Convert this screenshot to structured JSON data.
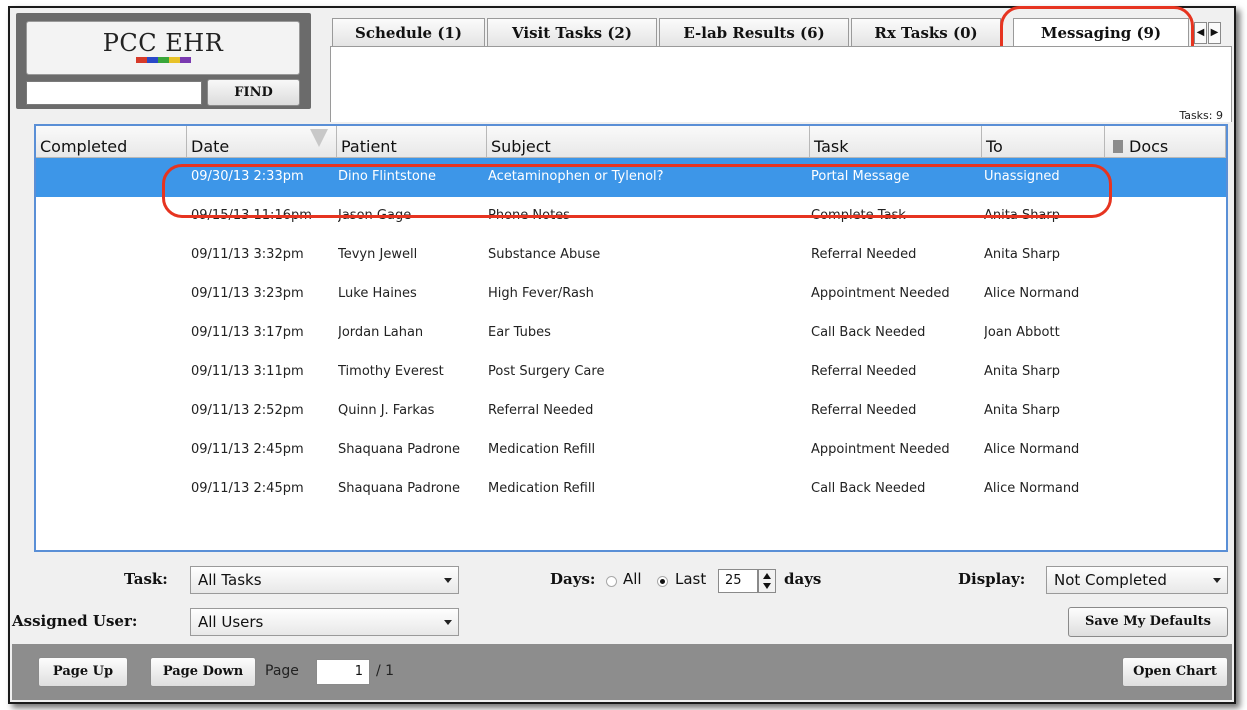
{
  "logo": {
    "text": "PCC EHR",
    "bar_colors": [
      "#d63a2a",
      "#2a49c8",
      "#3aa63a",
      "#e8c228",
      "#7a3ab0"
    ]
  },
  "find": {
    "value": "",
    "button_label": "FIND"
  },
  "tabs": [
    {
      "label": "Schedule (1)"
    },
    {
      "label": "Visit Tasks (2)"
    },
    {
      "label": "E-lab Results (6)"
    },
    {
      "label": "Rx Tasks (0)"
    },
    {
      "label": "Messaging (9)",
      "active": true
    }
  ],
  "tab_scroll": {
    "left_icon": "triangle-left-icon",
    "right_icon": "triangle-right-icon",
    "left": "◀",
    "right": "▶"
  },
  "tasks_count": "Tasks: 9",
  "table": {
    "columns": [
      "Completed",
      "Date",
      "Patient",
      "Subject",
      "Task",
      "To",
      "Docs"
    ],
    "rows": [
      {
        "completed": "",
        "date": "09/30/13 2:33pm",
        "patient": "Dino Flintstone",
        "subject": "Acetaminophen or Tylenol?",
        "task": "Portal Message",
        "to": "Unassigned",
        "selected": true
      },
      {
        "completed": "",
        "date": "09/15/13 11:16pm",
        "patient": "Jason Gage",
        "subject": "Phone Notes",
        "task": "Complete Task",
        "to": "Anita Sharp"
      },
      {
        "completed": "",
        "date": "09/11/13 3:32pm",
        "patient": "Tevyn Jewell",
        "subject": "Substance Abuse",
        "task": "Referral Needed",
        "to": "Anita Sharp"
      },
      {
        "completed": "",
        "date": "09/11/13 3:23pm",
        "patient": "Luke Haines",
        "subject": "High Fever/Rash",
        "task": "Appointment Needed",
        "to": "Alice Normand"
      },
      {
        "completed": "",
        "date": "09/11/13 3:17pm",
        "patient": "Jordan Lahan",
        "subject": "Ear Tubes",
        "task": "Call Back Needed",
        "to": "Joan Abbott"
      },
      {
        "completed": "",
        "date": "09/11/13 3:11pm",
        "patient": "Timothy Everest",
        "subject": "Post Surgery Care",
        "task": "Referral Needed",
        "to": "Anita Sharp"
      },
      {
        "completed": "",
        "date": "09/11/13 2:52pm",
        "patient": "Quinn J. Farkas",
        "subject": "Referral Needed",
        "task": "Referral Needed",
        "to": "Anita Sharp"
      },
      {
        "completed": "",
        "date": "09/11/13 2:45pm",
        "patient": "Shaquana Padrone",
        "subject": "Medication Refill",
        "task": "Appointment Needed",
        "to": "Alice Normand"
      },
      {
        "completed": "",
        "date": "09/11/13 2:45pm",
        "patient": "Shaquana Padrone",
        "subject": "Medication Refill",
        "task": "Call Back Needed",
        "to": "Alice Normand"
      }
    ]
  },
  "filters": {
    "task_label": "Task:",
    "task_value": "All Tasks",
    "assigned_label": "Assigned User:",
    "assigned_value": "All Users",
    "days_label": "Days:",
    "days_all_label": "All",
    "days_last_label": "Last",
    "days_value": "25",
    "days_suffix": "days",
    "display_label": "Display:",
    "display_value": "Not Completed",
    "save_defaults_label": "Save My Defaults"
  },
  "pager": {
    "page_up_label": "Page Up",
    "page_down_label": "Page Down",
    "page_label": "Page",
    "page_value": "1",
    "page_total": "/ 1",
    "open_chart_label": "Open Chart"
  },
  "colors": {
    "selection": "#3d96e8",
    "highlight_ring": "#e63420",
    "grid_border": "#5a8fd6"
  }
}
